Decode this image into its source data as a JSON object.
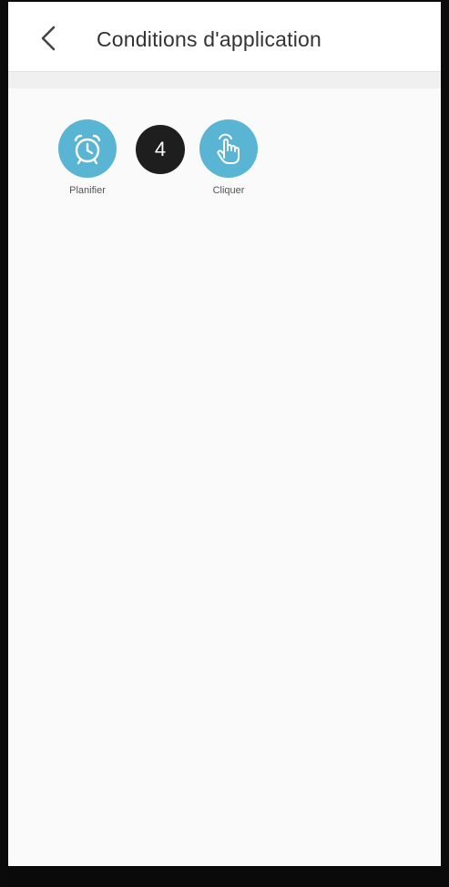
{
  "header": {
    "title": "Conditions d'application",
    "back_icon": "chevron-left-icon"
  },
  "conditions": [
    {
      "label": "Planifier",
      "icon": "alarm-clock-icon",
      "color": "#5ab4d3"
    },
    {
      "value": "4",
      "color": "#1e1e1e"
    },
    {
      "label": "Cliquer",
      "icon": "tap-hand-icon",
      "color": "#5ab4d3"
    }
  ]
}
